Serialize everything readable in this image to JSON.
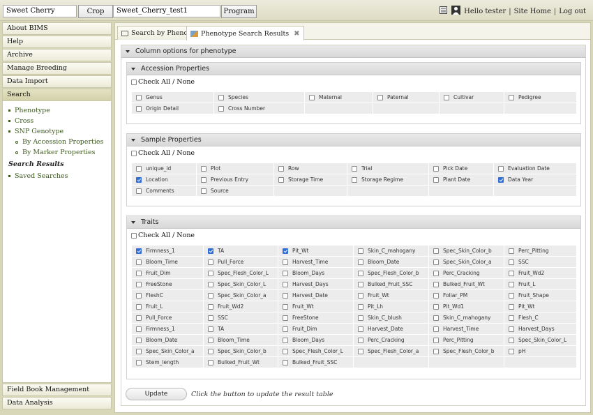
{
  "topbar": {
    "crop_value": "Sweet Cherry",
    "crop_button": "Crop",
    "program_value": "Sweet_Cherry_test1",
    "program_button": "Program",
    "greeting": "Hello tester",
    "site_home": "Site Home",
    "logout": "Log out"
  },
  "sidebar": {
    "items_top": [
      "About BIMS",
      "Help",
      "Archive",
      "Manage Breeding",
      "Data Import",
      "Search"
    ],
    "search_links": [
      "Phenotype",
      "Cross",
      "SNP Genotype"
    ],
    "snp_sub": [
      "By Accession Properties",
      "By Marker Properties"
    ],
    "results_header": "Search Results",
    "saved": "Saved Searches",
    "items_bottom": [
      "Field Book Management",
      "Data Analysis"
    ]
  },
  "tabs": {
    "search": "Search by Phenotype",
    "results": "Phenotype Search Results",
    "close": "✖"
  },
  "panel": {
    "title": "Column options for phenotype",
    "check_all": "Check All / None",
    "update_button": "Update",
    "update_hint": "Click the button to update the result table"
  },
  "accession": {
    "title": "Accession Properties",
    "rows": [
      [
        {
          "label": "Genus",
          "checked": false
        },
        {
          "label": "Species",
          "checked": false
        },
        {
          "label": "Maternal",
          "checked": false
        },
        {
          "label": "Paternal",
          "checked": false
        },
        {
          "label": "Cultivar",
          "checked": false
        },
        {
          "label": "Pedigree",
          "checked": false
        }
      ],
      [
        {
          "label": "Origin Detail",
          "checked": false
        },
        {
          "label": "Cross Number",
          "checked": false
        },
        null,
        null,
        null,
        null
      ]
    ]
  },
  "sample": {
    "title": "Sample Properties",
    "rows": [
      [
        {
          "label": "unique_id",
          "checked": false
        },
        {
          "label": "Plot",
          "checked": false
        },
        {
          "label": "Row",
          "checked": false
        },
        {
          "label": "Trial",
          "checked": false
        },
        {
          "label": "Pick Date",
          "checked": false
        },
        {
          "label": "Evaluation Date",
          "checked": false
        }
      ],
      [
        {
          "label": "Location",
          "checked": true
        },
        {
          "label": "Previous Entry",
          "checked": false
        },
        {
          "label": "Storage Time",
          "checked": false
        },
        {
          "label": "Storage Regime",
          "checked": false
        },
        {
          "label": "Plant Date",
          "checked": false
        },
        {
          "label": "Data Year",
          "checked": true
        }
      ],
      [
        {
          "label": "Comments",
          "checked": false
        },
        {
          "label": "Source",
          "checked": false
        },
        null,
        null,
        null,
        null
      ]
    ]
  },
  "traits": {
    "title": "Traits",
    "rows": [
      [
        {
          "label": "Firmness_1",
          "checked": true
        },
        {
          "label": "TA",
          "checked": true
        },
        {
          "label": "Pit_Wt",
          "checked": true
        },
        {
          "label": "Skin_C_mahogany",
          "checked": false
        },
        {
          "label": "Spec_Skin_Color_b",
          "checked": false
        },
        {
          "label": "Perc_Pitting",
          "checked": false
        }
      ],
      [
        {
          "label": "Bloom_Time",
          "checked": false
        },
        {
          "label": "Pull_Force",
          "checked": false
        },
        {
          "label": "Harvest_Time",
          "checked": false
        },
        {
          "label": "Bloom_Date",
          "checked": false
        },
        {
          "label": "Spec_Skin_Color_a",
          "checked": false
        },
        {
          "label": "SSC",
          "checked": false
        }
      ],
      [
        {
          "label": "Fruit_Dim",
          "checked": false
        },
        {
          "label": "Spec_Flesh_Color_L",
          "checked": false
        },
        {
          "label": "Bloom_Days",
          "checked": false
        },
        {
          "label": "Spec_Flesh_Color_b",
          "checked": false
        },
        {
          "label": "Perc_Cracking",
          "checked": false
        },
        {
          "label": "Fruit_Wd2",
          "checked": false
        }
      ],
      [
        {
          "label": "FreeStone",
          "checked": false
        },
        {
          "label": "Spec_Skin_Color_L",
          "checked": false
        },
        {
          "label": "Harvest_Days",
          "checked": false
        },
        {
          "label": "Bulked_Fruit_SSC",
          "checked": false
        },
        {
          "label": "Bulked_Fruit_Wt",
          "checked": false
        },
        {
          "label": "Fruit_L",
          "checked": false
        }
      ],
      [
        {
          "label": "FleshC",
          "checked": false
        },
        {
          "label": "Spec_Skin_Color_a",
          "checked": false
        },
        {
          "label": "Harvest_Date",
          "checked": false
        },
        {
          "label": "Fruit_Wt",
          "checked": false
        },
        {
          "label": "Foliar_PM",
          "checked": false
        },
        {
          "label": "Fruit_Shape",
          "checked": false
        }
      ],
      [
        {
          "label": "Fruit_L",
          "checked": false
        },
        {
          "label": "Fruit_Wd2",
          "checked": false
        },
        {
          "label": "Fruit_Wt",
          "checked": false
        },
        {
          "label": "Pit_Lh",
          "checked": false
        },
        {
          "label": "Pit_Wd1",
          "checked": false
        },
        {
          "label": "Pit_Wt",
          "checked": false
        }
      ],
      [
        {
          "label": "Pull_Force",
          "checked": false
        },
        {
          "label": "SSC",
          "checked": false
        },
        {
          "label": "FreeStone",
          "checked": false
        },
        {
          "label": "Skin_C_blush",
          "checked": false
        },
        {
          "label": "Skin_C_mahogany",
          "checked": false
        },
        {
          "label": "Flesh_C",
          "checked": false
        }
      ],
      [
        {
          "label": "Firmness_1",
          "checked": false
        },
        {
          "label": "TA",
          "checked": false
        },
        {
          "label": "Fruit_Dim",
          "checked": false
        },
        {
          "label": "Harvest_Date",
          "checked": false
        },
        {
          "label": "Harvest_Time",
          "checked": false
        },
        {
          "label": "Harvest_Days",
          "checked": false
        }
      ],
      [
        {
          "label": "Bloom_Date",
          "checked": false
        },
        {
          "label": "Bloom_Time",
          "checked": false
        },
        {
          "label": "Bloom_Days",
          "checked": false
        },
        {
          "label": "Perc_Cracking",
          "checked": false
        },
        {
          "label": "Perc_Pitting",
          "checked": false
        },
        {
          "label": "Spec_Skin_Color_L",
          "checked": false
        }
      ],
      [
        {
          "label": "Spec_Skin_Color_a",
          "checked": false
        },
        {
          "label": "Spec_Skin_Color_b",
          "checked": false
        },
        {
          "label": "Spec_Flesh_Color_L",
          "checked": false
        },
        {
          "label": "Spec_Flesh_Color_a",
          "checked": false
        },
        {
          "label": "Spec_Flesh_Color_b",
          "checked": false
        },
        {
          "label": "pH",
          "checked": false
        }
      ],
      [
        {
          "label": "Stem_length",
          "checked": false
        },
        {
          "label": "Bulked_Fruit_Wt",
          "checked": false
        },
        {
          "label": "Bulked_Fruit_SSC",
          "checked": false
        },
        null,
        null,
        null
      ]
    ]
  }
}
